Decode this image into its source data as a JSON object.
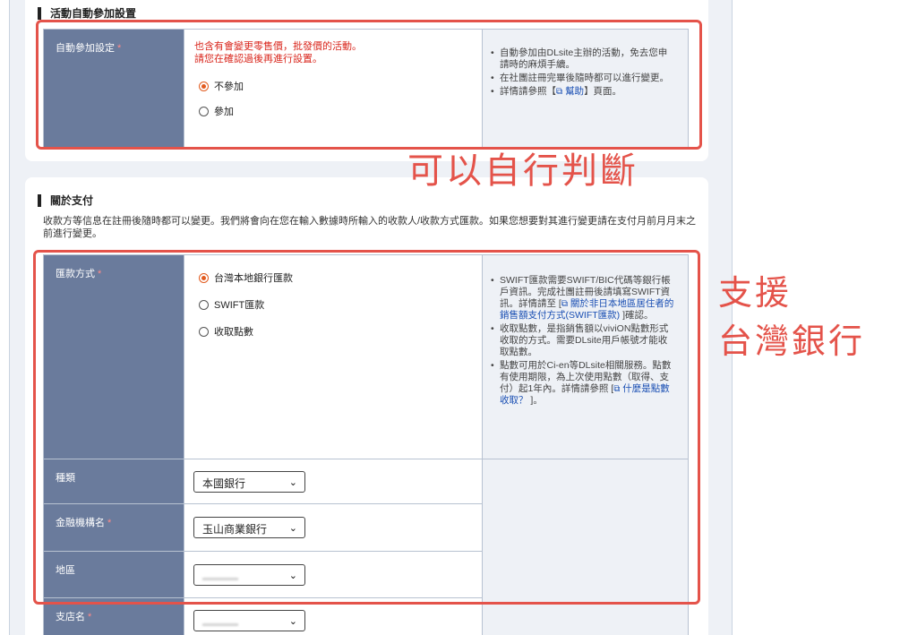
{
  "section_auto": {
    "title": "活動自動參加設置",
    "label": "自動參加設定",
    "required": "*",
    "warning_line1": "也含有會變更零售價，批發價的活動。",
    "warning_line2": "請您在確認過後再進行設置。",
    "options": [
      {
        "label": "不參加",
        "selected": true
      },
      {
        "label": "參加",
        "selected": false
      }
    ],
    "notes": [
      "自動參加由DLsite主辦的活動，免去您申請時的麻煩手續。",
      "在社團註冊完畢後隨時都可以進行變更。"
    ],
    "help_prefix": "詳情請參照【",
    "help_link": "幫助",
    "help_suffix": "】頁面。"
  },
  "section_payment": {
    "title": "關於支付",
    "description": "收款方等信息在註冊後隨時都可以變更。我們將會向在您在輸入數據時所輸入的收款人/收款方式匯款。如果您想要對其進行變更請在支付月前月月末之前進行變更。",
    "method": {
      "label": "匯款方式",
      "required": "*",
      "options": [
        {
          "label": "台灣本地銀行匯款",
          "selected": true
        },
        {
          "label": "SWIFT匯款",
          "selected": false
        },
        {
          "label": "收取點數",
          "selected": false
        }
      ],
      "note1_text": "SWIFT匯款需要SWIFT/BIC代碼等銀行帳戶資訊。完成社團註冊後請填寫SWIFT資訊。詳情請至 [",
      "note1_link": "關於非日本地區居住者的銷售額支付方式(SWIFT匯款)",
      "note1_suffix": " ]確認。",
      "note2": "收取點數，是指銷售額以viviON點數形式收取的方式。需要DLsite用戶帳號才能收取點數。",
      "note3_text": "點數可用於Ci-en等DLsite相關服務。點數有使用期限，為上次使用點數（取得、支付）起1年內。詳情請參照 [",
      "note3_link": "什麼是點數收取？",
      "note3_suffix": " ]。"
    },
    "type": {
      "label": "種類",
      "selected": "本國銀行"
    },
    "bank": {
      "label": "金融機構名",
      "required": "*",
      "selected": "玉山商業銀行"
    },
    "region": {
      "label": "地區"
    },
    "branch": {
      "label": "支店名",
      "required": "*"
    }
  },
  "annotations": {
    "note_1": "可以自行判斷",
    "note_2_line1": "支援",
    "note_2_line2": "台灣銀行"
  },
  "colors": {
    "label_bg": "#6a7b9c",
    "highlight": "#e4534a",
    "warning": "#d9261c",
    "link": "#1a4fb3"
  }
}
